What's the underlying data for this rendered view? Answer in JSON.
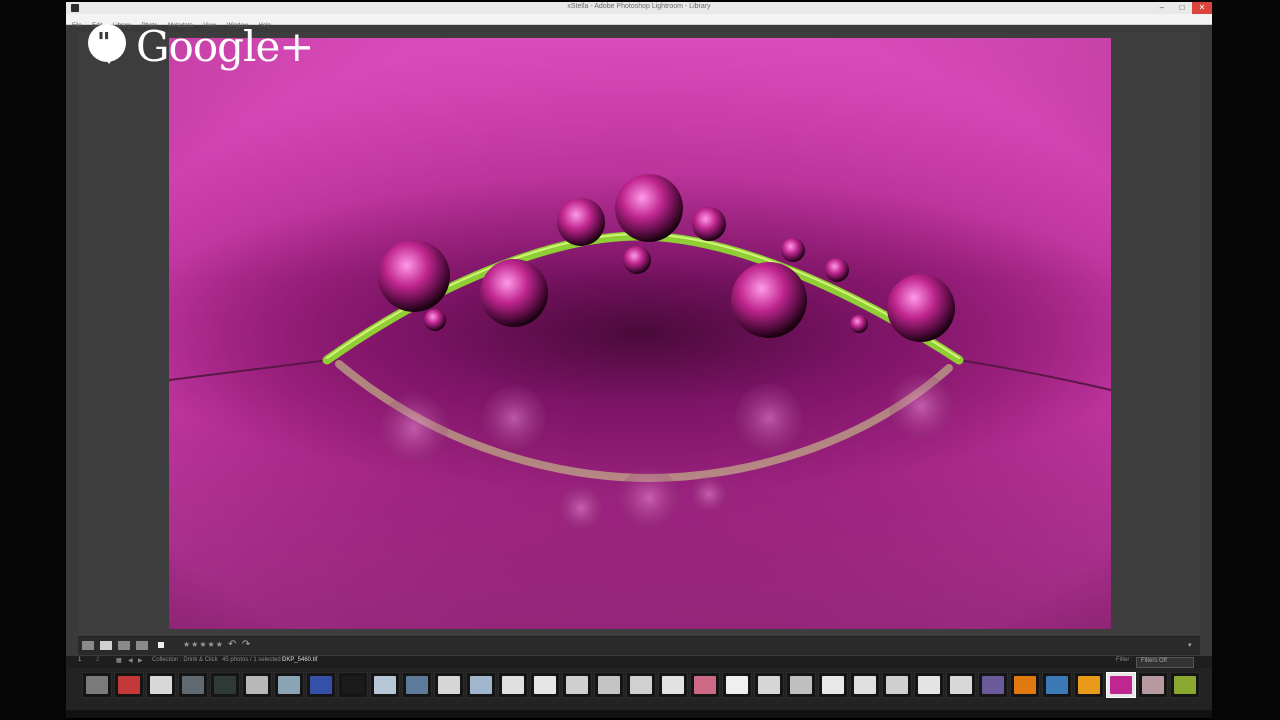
{
  "window": {
    "title": "xStella - Adobe Photoshop Lightroom - Library",
    "menu": [
      "File",
      "Edit",
      "Library",
      "Photo",
      "Metadata",
      "View",
      "Window",
      "Help"
    ]
  },
  "watermark": {
    "text": "Google+"
  },
  "toolbar": {
    "stars": "★★★★★"
  },
  "filmstrip_header": {
    "collection": "Collection : Drink & Click",
    "count": "45 photos / 1 selected /",
    "filename": "DKP_5460.tif",
    "filter_label": "Filter :",
    "filter_value": "Filters Off"
  },
  "filmstrip": {
    "thumbs": [
      {
        "color": "#7a7a7a"
      },
      {
        "color": "#c33838"
      },
      {
        "color": "#d8d8d8"
      },
      {
        "color": "#606a70"
      },
      {
        "color": "#2e3a33"
      },
      {
        "color": "#b8b8b8"
      },
      {
        "color": "#8aa3b5"
      },
      {
        "color": "#3450a8"
      },
      {
        "color": "#1b1b1b"
      },
      {
        "color": "#b7c7d8"
      },
      {
        "color": "#5d7a9a"
      },
      {
        "color": "#d6d6d6"
      },
      {
        "color": "#9fb6cc"
      },
      {
        "color": "#e0e0e0"
      },
      {
        "color": "#e6e6e6"
      },
      {
        "color": "#cfcfcf"
      },
      {
        "color": "#c4c4c4"
      },
      {
        "color": "#d0d0d0"
      },
      {
        "color": "#e2e2e2"
      },
      {
        "color": "#cc6a86"
      },
      {
        "color": "#efefef"
      },
      {
        "color": "#d6d6d6"
      },
      {
        "color": "#bfbfbf"
      },
      {
        "color": "#e8e8e8"
      },
      {
        "color": "#e0e0e0"
      },
      {
        "color": "#cfcfcf"
      },
      {
        "color": "#e4e4e4"
      },
      {
        "color": "#d8d8d8"
      },
      {
        "color": "#6a5a9a"
      },
      {
        "color": "#e07a10"
      },
      {
        "color": "#3a78b6"
      },
      {
        "color": "#e89a18"
      },
      {
        "color": "#c0268f",
        "active": true
      },
      {
        "color": "#b69aa0"
      },
      {
        "color": "#8aa830"
      }
    ]
  },
  "colors": {
    "accent": "#d9453a",
    "panel": "#3a3a3a",
    "photo_magenta": "#b0298f"
  }
}
